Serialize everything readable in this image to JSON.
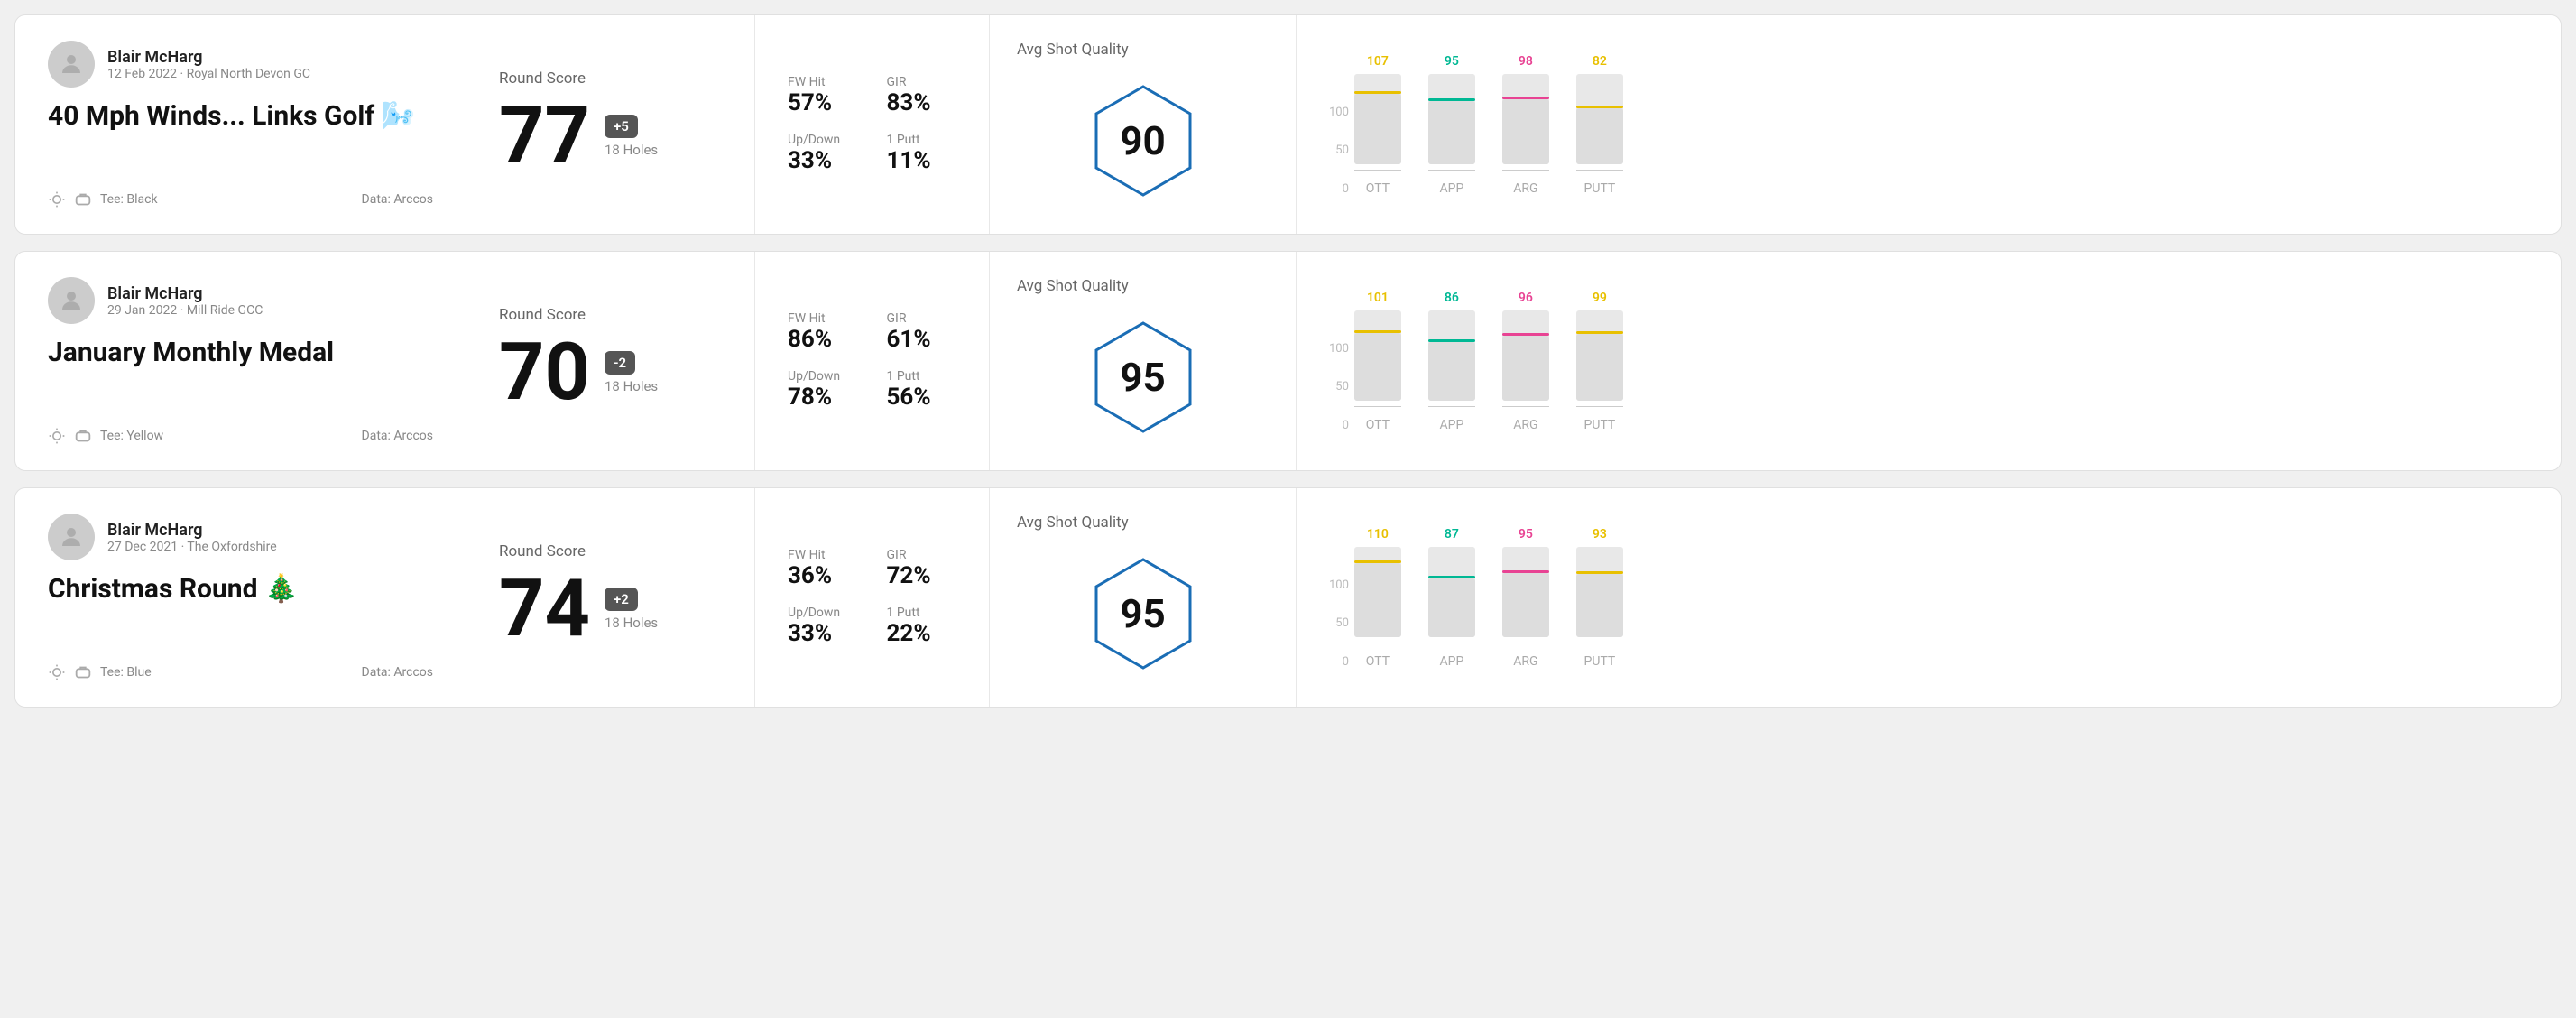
{
  "rounds": [
    {
      "id": "round1",
      "user": {
        "name": "Blair McHarg",
        "date": "12 Feb 2022 · Royal North Devon GC"
      },
      "title": "40 Mph Winds... Links Golf 🌬️",
      "tee": "Black",
      "data_source": "Data: Arccos",
      "score": {
        "label": "Round Score",
        "value": "77",
        "badge": "+5",
        "holes": "18 Holes"
      },
      "stats": {
        "fw_hit_label": "FW Hit",
        "fw_hit_value": "57%",
        "gir_label": "GIR",
        "gir_value": "83%",
        "updown_label": "Up/Down",
        "updown_value": "33%",
        "one_putt_label": "1 Putt",
        "one_putt_value": "11%"
      },
      "quality": {
        "label": "Avg Shot Quality",
        "score": "90"
      },
      "chart": {
        "bars": [
          {
            "label": "OTT",
            "top_value": "107",
            "color": "#e8c000",
            "fill_pct": 78
          },
          {
            "label": "APP",
            "top_value": "95",
            "color": "#00b894",
            "fill_pct": 70
          },
          {
            "label": "ARG",
            "top_value": "98",
            "color": "#e84393",
            "fill_pct": 72
          },
          {
            "label": "PUTT",
            "top_value": "82",
            "color": "#e8c000",
            "fill_pct": 62
          }
        ]
      }
    },
    {
      "id": "round2",
      "user": {
        "name": "Blair McHarg",
        "date": "29 Jan 2022 · Mill Ride GCC"
      },
      "title": "January Monthly Medal",
      "tee": "Yellow",
      "data_source": "Data: Arccos",
      "score": {
        "label": "Round Score",
        "value": "70",
        "badge": "-2",
        "holes": "18 Holes"
      },
      "stats": {
        "fw_hit_label": "FW Hit",
        "fw_hit_value": "86%",
        "gir_label": "GIR",
        "gir_value": "61%",
        "updown_label": "Up/Down",
        "updown_value": "78%",
        "one_putt_label": "1 Putt",
        "one_putt_value": "56%"
      },
      "quality": {
        "label": "Avg Shot Quality",
        "score": "95"
      },
      "chart": {
        "bars": [
          {
            "label": "OTT",
            "top_value": "101",
            "color": "#e8c000",
            "fill_pct": 75
          },
          {
            "label": "APP",
            "top_value": "86",
            "color": "#00b894",
            "fill_pct": 65
          },
          {
            "label": "ARG",
            "top_value": "96",
            "color": "#e84393",
            "fill_pct": 72
          },
          {
            "label": "PUTT",
            "top_value": "99",
            "color": "#e8c000",
            "fill_pct": 74
          }
        ]
      }
    },
    {
      "id": "round3",
      "user": {
        "name": "Blair McHarg",
        "date": "27 Dec 2021 · The Oxfordshire"
      },
      "title": "Christmas Round 🎄",
      "tee": "Blue",
      "data_source": "Data: Arccos",
      "score": {
        "label": "Round Score",
        "value": "74",
        "badge": "+2",
        "holes": "18 Holes"
      },
      "stats": {
        "fw_hit_label": "FW Hit",
        "fw_hit_value": "36%",
        "gir_label": "GIR",
        "gir_value": "72%",
        "updown_label": "Up/Down",
        "updown_value": "33%",
        "one_putt_label": "1 Putt",
        "one_putt_value": "22%"
      },
      "quality": {
        "label": "Avg Shot Quality",
        "score": "95"
      },
      "chart": {
        "bars": [
          {
            "label": "OTT",
            "top_value": "110",
            "color": "#e8c000",
            "fill_pct": 82
          },
          {
            "label": "APP",
            "top_value": "87",
            "color": "#00b894",
            "fill_pct": 65
          },
          {
            "label": "ARG",
            "top_value": "95",
            "color": "#e84393",
            "fill_pct": 71
          },
          {
            "label": "PUTT",
            "top_value": "93",
            "color": "#e8c000",
            "fill_pct": 70
          }
        ]
      }
    }
  ]
}
